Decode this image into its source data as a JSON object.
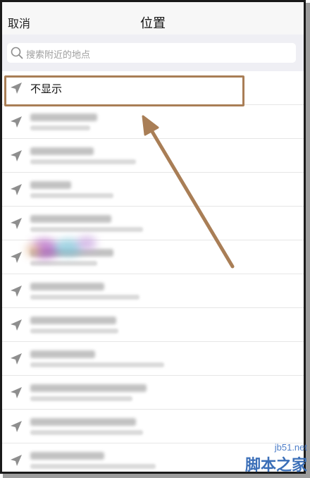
{
  "header": {
    "cancel_label": "取消",
    "title": "位置"
  },
  "search": {
    "placeholder": "搜索附近的地点"
  },
  "list": {
    "first_item_label": "不显示"
  },
  "watermark": {
    "url": "jb51.net",
    "name": "脚本之家"
  },
  "colors": {
    "highlight_border": "#a97e56",
    "arrow": "#a97e56",
    "header_bg": "#f7f7f7",
    "search_bg": "#efeff4",
    "icon_gray": "#8e8e8e",
    "watermark_blue": "#3b6fb8"
  },
  "icons": {
    "search": "search-icon",
    "location": "location-arrow-icon"
  }
}
